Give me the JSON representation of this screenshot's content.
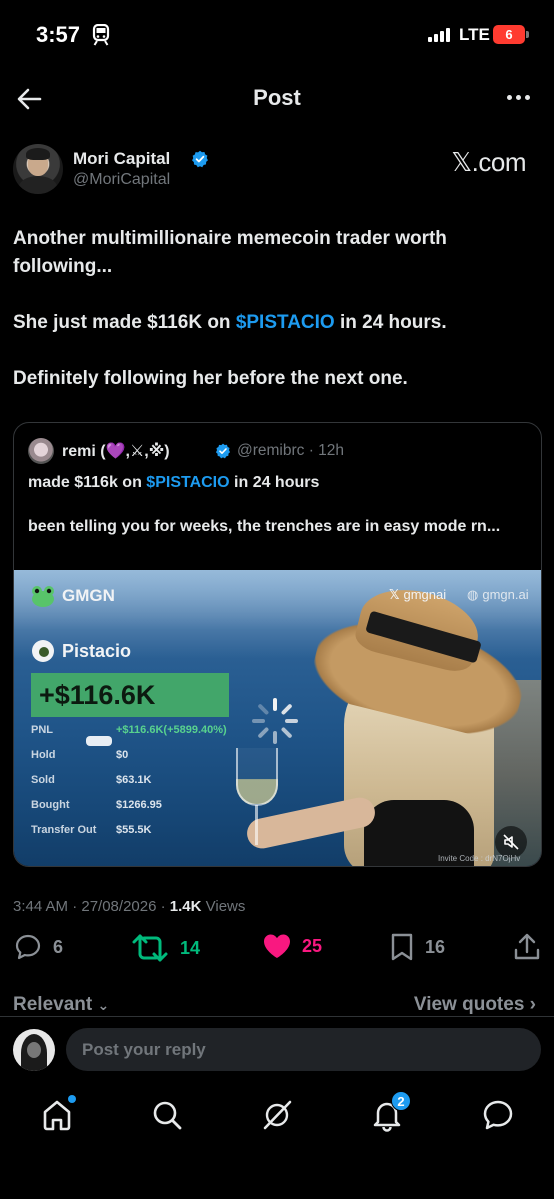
{
  "status_bar": {
    "time": "3:57",
    "network": "LTE",
    "battery": "6"
  },
  "header": {
    "title": "Post"
  },
  "author": {
    "name": "Mori Capital",
    "handle": "@MoriCapital",
    "source": "𝕏.com"
  },
  "post": {
    "line1": "Another multimillionaire memecoin trader worth following...",
    "line2_pre": "She just made $116K on ",
    "line2_tag": "$PISTACIO",
    "line2_post": " in 24 hours.",
    "line3": "Definitely following her before the next one."
  },
  "quote": {
    "name": "remi (💜,⚔,※)",
    "handle_time": "@remibrc · 12h",
    "line1_pre": "made $116k on ",
    "line1_tag": "$PISTACIO",
    "line1_post": " in 24 hours",
    "line2": "been telling you for weeks, the trenches are in easy mode rn...",
    "card": {
      "brand": "GMGN",
      "x_handle": "gmgnai",
      "site": "gmgn.ai",
      "token": "Pistacio",
      "pnl_big": "+$116.6K",
      "stats": [
        {
          "label": "PNL",
          "value": "+$116.6K(+5899.40%)"
        },
        {
          "label": "Hold",
          "value": "$0"
        },
        {
          "label": "Sold",
          "value": "$63.1K"
        },
        {
          "label": "Bought",
          "value": "$1266.95"
        },
        {
          "label": "Transfer Out",
          "value": "$55.5K"
        }
      ],
      "invite": "Invite Code : drN7OjHv"
    }
  },
  "meta": {
    "datetime": "3:44 AM · 27/08/2026 · ",
    "views": "1.4K",
    "views_label": " Views"
  },
  "actions": {
    "replies": "6",
    "reposts": "14",
    "likes": "25",
    "bookmarks": "16"
  },
  "sort": {
    "label": "Relevant",
    "view_quotes": "View quotes"
  },
  "reply": {
    "placeholder": "Post your reply"
  },
  "nav": {
    "notifications_badge": "2"
  },
  "colors": {
    "accent": "#1d9bf0",
    "repost": "#00ba7c",
    "like": "#f91880"
  }
}
